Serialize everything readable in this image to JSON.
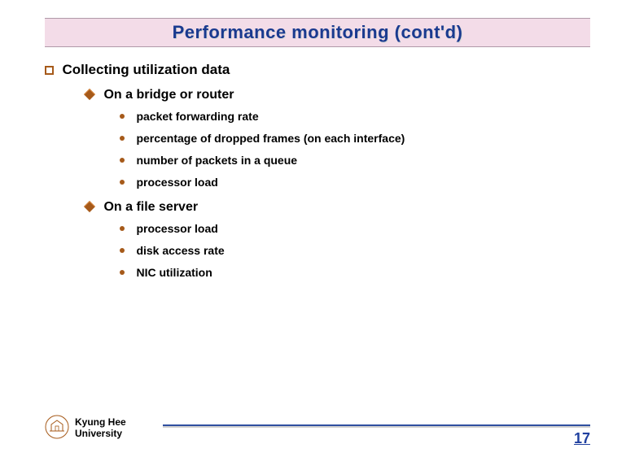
{
  "title": "Performance monitoring (cont'd)",
  "heading": "Collecting utilization data",
  "sections": [
    {
      "label": "On a bridge or router",
      "items": [
        "packet forwarding rate",
        "percentage of dropped frames (on each interface)",
        "number of packets in a queue",
        "processor load"
      ]
    },
    {
      "label": "On a file server",
      "items": [
        "processor load",
        "disk access rate",
        "NIC utilization"
      ]
    }
  ],
  "footer": {
    "university_line1": "Kyung Hee",
    "university_line2": "University",
    "page": "17"
  }
}
